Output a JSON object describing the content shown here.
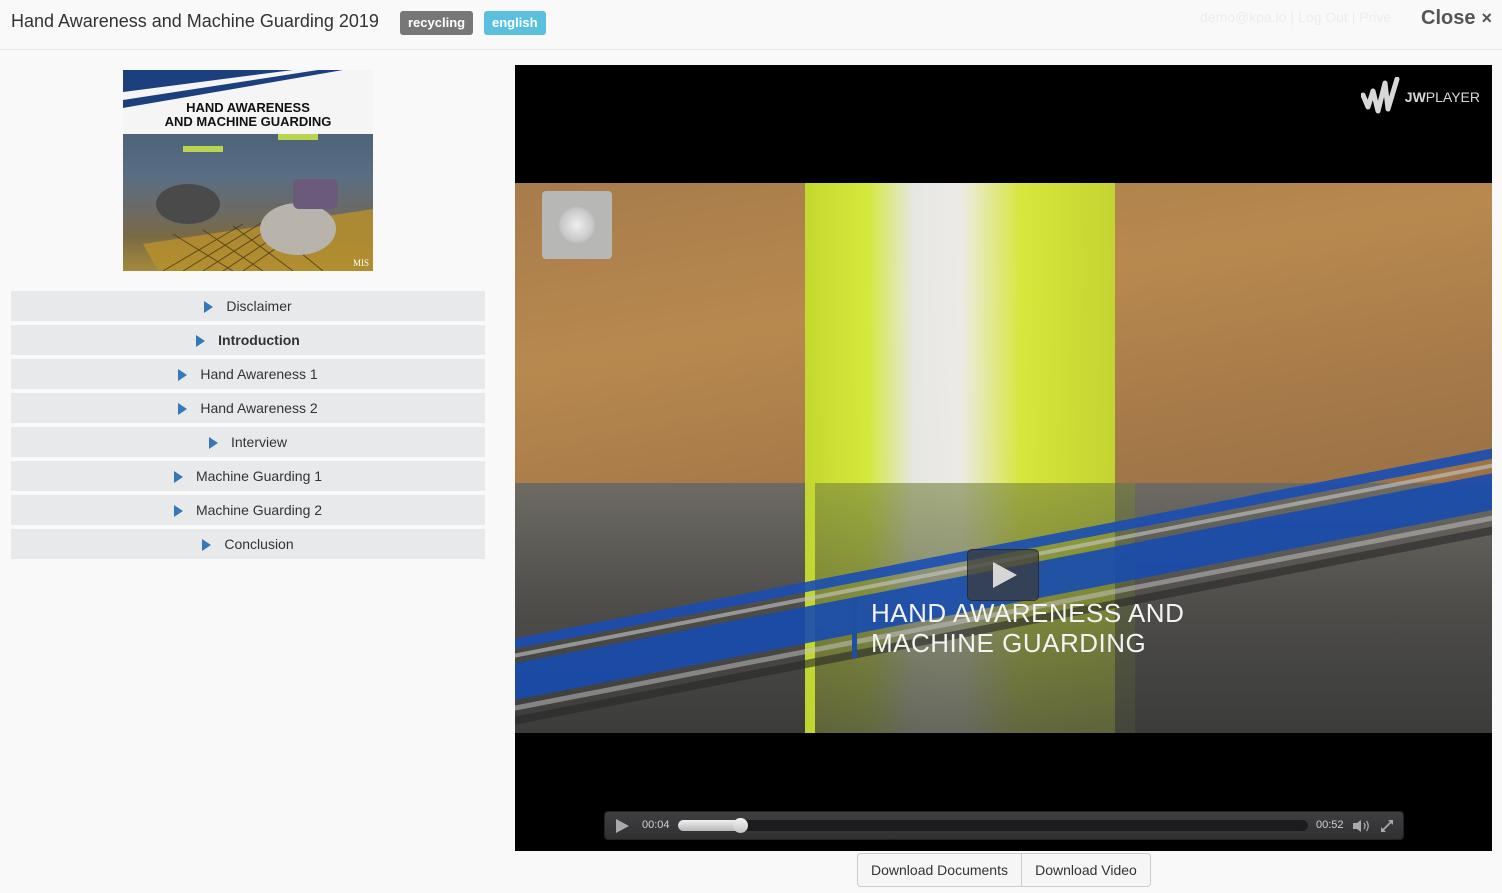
{
  "header": {
    "title": "Hand Awareness and Machine Guarding 2019",
    "badges": [
      {
        "label": "recycling",
        "color": "#777777"
      },
      {
        "label": "english",
        "color": "#5bc0de"
      }
    ],
    "close_label": "Close",
    "close_icon": "×",
    "background_user_text": "demo@kpa.io | Log Out | Prive"
  },
  "thumbnail": {
    "title_line1": "HAND AWARENESS",
    "title_line2": "AND MACHINE GUARDING",
    "watermark": "MIS"
  },
  "chapters": [
    {
      "label": "Disclaimer",
      "active": false
    },
    {
      "label": "Introduction",
      "active": true
    },
    {
      "label": "Hand Awareness 1",
      "active": false
    },
    {
      "label": "Hand Awareness 2",
      "active": false
    },
    {
      "label": "Interview",
      "active": false
    },
    {
      "label": "Machine Guarding 1",
      "active": false
    },
    {
      "label": "Machine Guarding 2",
      "active": false
    },
    {
      "label": "Conclusion",
      "active": false
    }
  ],
  "player": {
    "brand_bold": "JW",
    "brand_rest": "PLAYER",
    "overlay_line1": "HAND AWARENESS AND",
    "overlay_line2": "MACHINE GUARDING",
    "elapsed": "00:04",
    "duration": "00:52",
    "progress_seconds": 4,
    "duration_seconds": 52,
    "accent": "#1f4fa0"
  },
  "actions": {
    "download_documents": "Download Documents",
    "download_video": "Download Video"
  },
  "icons": {
    "chapter_play": "play-triangle-icon",
    "close": "close-icon",
    "volume": "volume-icon",
    "fullscreen": "fullscreen-icon"
  }
}
